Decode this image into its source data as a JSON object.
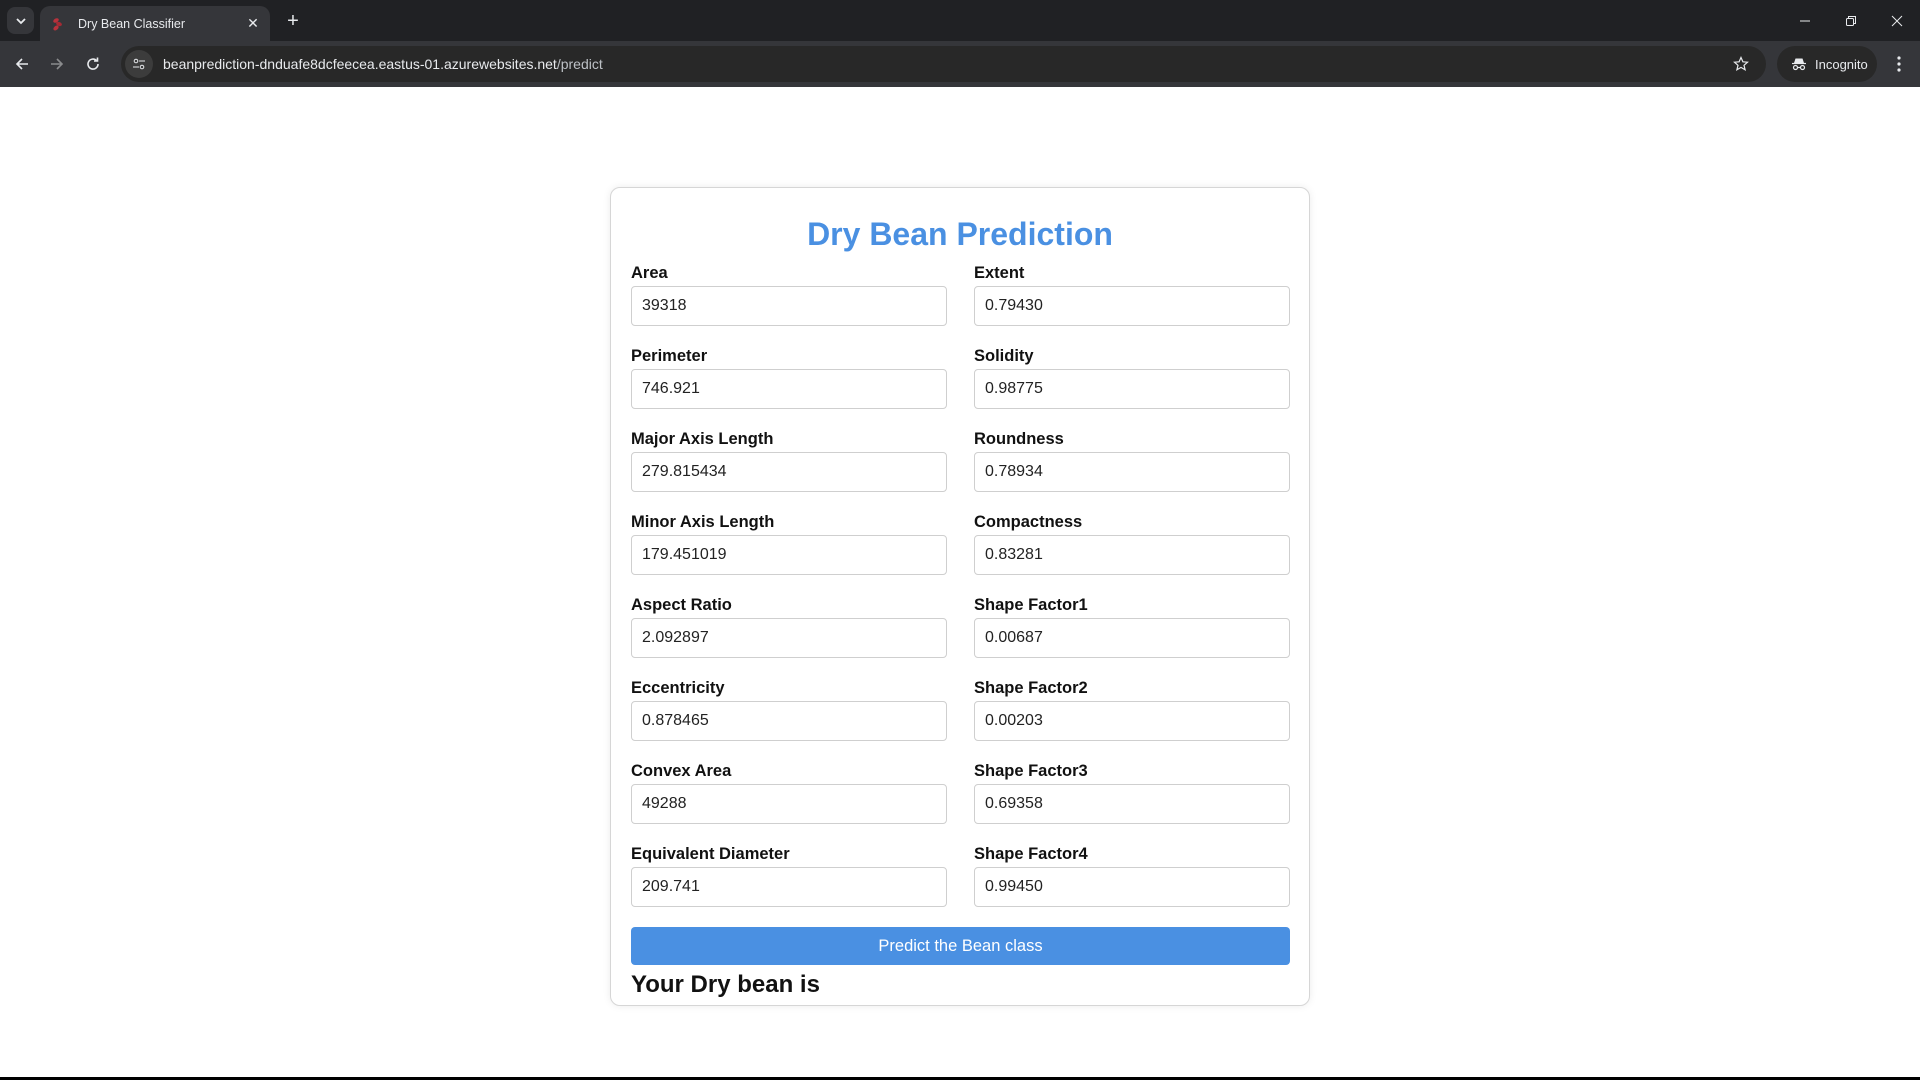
{
  "browser": {
    "tab_title": "Dry Bean Classifier",
    "url_host": "beanprediction-dnduafe8dcfeecea.eastus-01.azurewebsites.net",
    "url_path": "/predict",
    "profile_label": "Incognito"
  },
  "page": {
    "title": "Dry Bean Prediction",
    "fields": [
      {
        "label": "Area",
        "value": "39318"
      },
      {
        "label": "Extent",
        "value": "0.79430"
      },
      {
        "label": "Perimeter",
        "value": "746.921"
      },
      {
        "label": "Solidity",
        "value": "0.98775"
      },
      {
        "label": "Major Axis Length",
        "value": "279.815434"
      },
      {
        "label": "Roundness",
        "value": "0.78934"
      },
      {
        "label": "Minor Axis Length",
        "value": "179.451019"
      },
      {
        "label": "Compactness",
        "value": "0.83281"
      },
      {
        "label": "Aspect Ratio",
        "value": "2.092897"
      },
      {
        "label": "Shape Factor1",
        "value": "0.00687"
      },
      {
        "label": "Eccentricity",
        "value": "0.878465"
      },
      {
        "label": "Shape Factor2",
        "value": "0.00203"
      },
      {
        "label": "Convex Area",
        "value": "49288"
      },
      {
        "label": "Shape Factor3",
        "value": "0.69358"
      },
      {
        "label": "Equivalent Diameter",
        "value": "209.741"
      },
      {
        "label": "Shape Factor4",
        "value": "0.99450"
      }
    ],
    "submit_label": "Predict the Bean class",
    "result_text": "Your Dry bean is"
  },
  "colors": {
    "accent": "#4a90e2"
  }
}
